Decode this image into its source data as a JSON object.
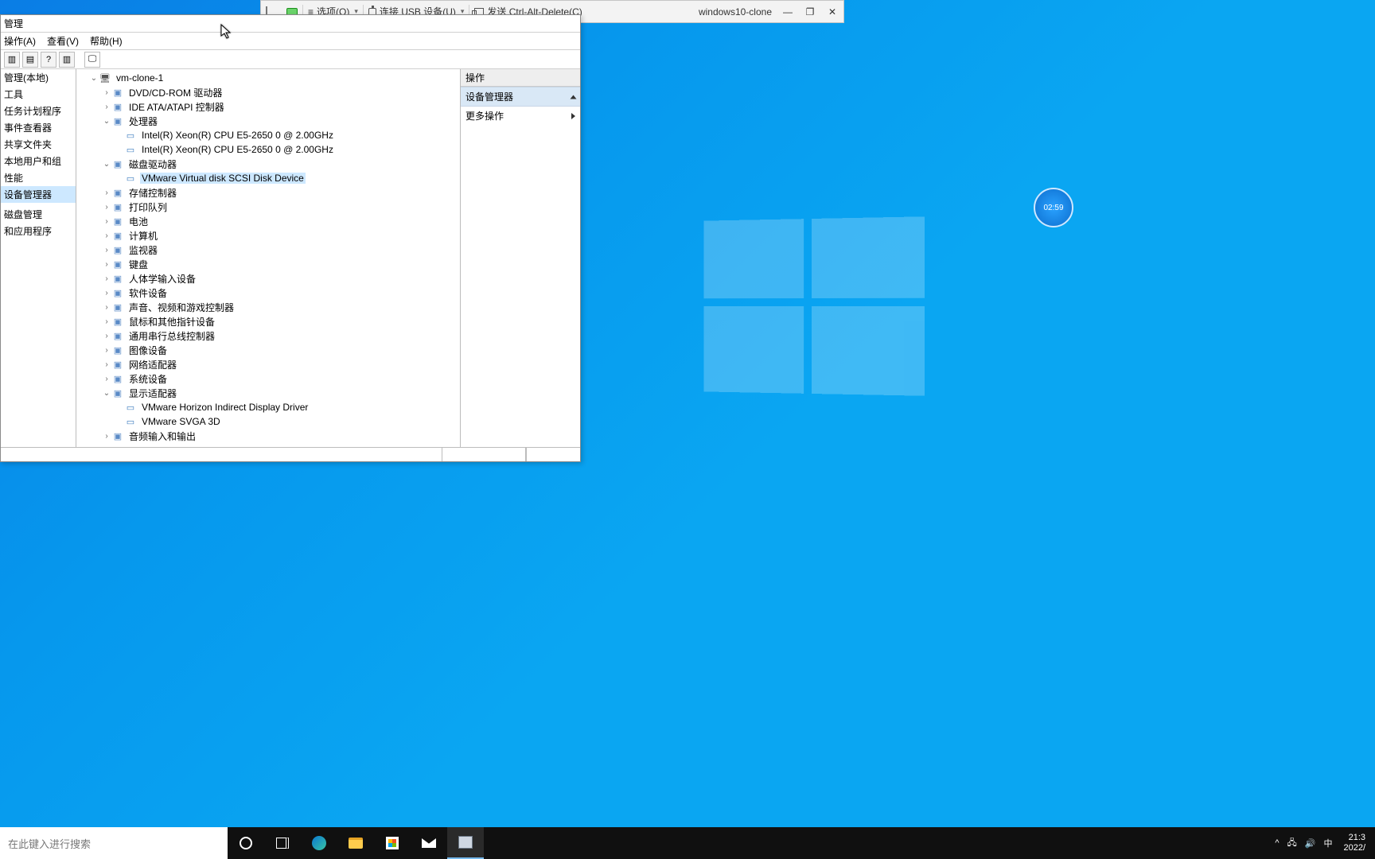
{
  "vm_bar": {
    "options": "选项(O)",
    "usb": "连接 USB 设备(U)",
    "cad": "发送 Ctrl-Alt-Delete(C)",
    "title": "windows10-clone"
  },
  "clock_widget": "02:59",
  "mmc": {
    "title": "管理",
    "menus": {
      "action": "操作(A)",
      "view": "查看(V)",
      "help": "帮助(H)"
    },
    "left": {
      "items": [
        "管理(本地)",
        "工具",
        "任务计划程序",
        "事件查看器",
        "共享文件夹",
        "本地用户和组",
        "性能",
        "设备管理器",
        "",
        "磁盘管理",
        "和应用程序"
      ],
      "selected_index": 7
    },
    "right": {
      "header": "操作",
      "band": "设备管理器",
      "more": "更多操作"
    }
  },
  "tree": {
    "root": "vm-clone-1",
    "nodes": [
      {
        "label": "DVD/CD-ROM 驱动器",
        "expand": "›"
      },
      {
        "label": "IDE ATA/ATAPI 控制器",
        "expand": "›"
      },
      {
        "label": "处理器",
        "expand": "⌄",
        "children": [
          "Intel(R) Xeon(R) CPU E5-2650 0 @ 2.00GHz",
          "Intel(R) Xeon(R) CPU E5-2650 0 @ 2.00GHz"
        ]
      },
      {
        "label": "磁盘驱动器",
        "expand": "⌄",
        "children_sel": 0,
        "children": [
          "VMware Virtual disk SCSI Disk Device"
        ]
      },
      {
        "label": "存储控制器",
        "expand": "›"
      },
      {
        "label": "打印队列",
        "expand": "›"
      },
      {
        "label": "电池",
        "expand": "›"
      },
      {
        "label": "计算机",
        "expand": "›"
      },
      {
        "label": "监视器",
        "expand": "›"
      },
      {
        "label": "键盘",
        "expand": "›"
      },
      {
        "label": "人体学输入设备",
        "expand": "›"
      },
      {
        "label": "软件设备",
        "expand": "›"
      },
      {
        "label": "声音、视频和游戏控制器",
        "expand": "›"
      },
      {
        "label": "鼠标和其他指针设备",
        "expand": "›"
      },
      {
        "label": "通用串行总线控制器",
        "expand": "›"
      },
      {
        "label": "图像设备",
        "expand": "›"
      },
      {
        "label": "网络适配器",
        "expand": "›"
      },
      {
        "label": "系统设备",
        "expand": "›"
      },
      {
        "label": "显示适配器",
        "expand": "⌄",
        "children": [
          "VMware Horizon Indirect Display Driver",
          "VMware SVGA 3D"
        ]
      },
      {
        "label": "音频输入和输出",
        "expand": "›"
      }
    ]
  },
  "taskbar": {
    "search_placeholder": "在此键入进行搜索",
    "ime": "中",
    "time": "21:3",
    "date": "2022/"
  }
}
